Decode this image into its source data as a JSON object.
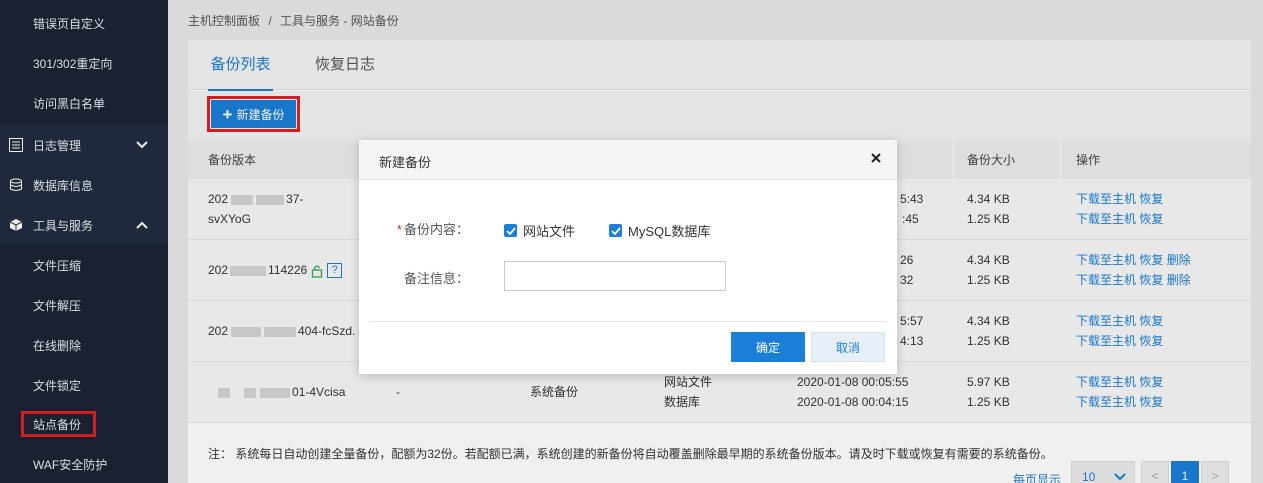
{
  "sidebar": {
    "items": [
      {
        "label": "错误页自定义"
      },
      {
        "label": "301/302重定向"
      },
      {
        "label": "访问黑白名单"
      },
      {
        "label": "日志管理"
      },
      {
        "label": "数据库信息"
      },
      {
        "label": "工具与服务"
      },
      {
        "label": "文件压缩"
      },
      {
        "label": "文件解压"
      },
      {
        "label": "在线删除"
      },
      {
        "label": "文件锁定"
      },
      {
        "label": "站点备份"
      },
      {
        "label": "WAF安全防护"
      }
    ]
  },
  "breadcrumb": {
    "home": "主机控制面板",
    "sep": "/",
    "current": "工具与服务 - 网站备份"
  },
  "tabs": [
    {
      "label": "备份列表"
    },
    {
      "label": "恢复日志"
    }
  ],
  "toolbar": {
    "new_label": "新建备份",
    "plus": "+"
  },
  "table": {
    "headers": [
      "备份版本",
      "备份大小",
      "操作"
    ],
    "rows": [
      {
        "ver1": "202",
        "ver1b": "37-",
        "ver2": "svXYoG",
        "time1": "5:43",
        "time2": ":45",
        "size1": "4.34 KB",
        "size2": "1.25 KB",
        "dl": "下载至主机",
        "rs": "恢复",
        "del": ""
      },
      {
        "ver1": "202",
        "ver1b": "114226",
        "help": "?",
        "time1": "26",
        "time2": "32",
        "size1": "4.34 KB",
        "size2": "1.25 KB",
        "dl": "下载至主机",
        "rs": "恢复",
        "del": "删除"
      },
      {
        "ver1": "202",
        "ver1b": "404-fcSzd.",
        "time1": "5:57",
        "time2": "4:13",
        "size1": "4.34 KB",
        "size2": "1.25 KB",
        "dl": "下载至主机",
        "rs": "恢复",
        "del": ""
      },
      {
        "ver1": "",
        "ver1b": "01-4Vcisa",
        "note": "-",
        "type": "系统备份",
        "c1": "网站文件",
        "c2": "数据库",
        "time1": "2020-01-08 00:05:55",
        "time2": "2020-01-08 00:04:15",
        "size1": "5.97 KB",
        "size2": "1.25 KB",
        "dl": "下载至主机",
        "rs": "恢复",
        "del": ""
      }
    ]
  },
  "footer_note": "注：  系统每日自动创建全量备份，配额为32份。若配额已满，系统创建的新备份将自动覆盖删除最早期的系统备份版本。请及时下载或恢复有需要的系统备份。",
  "pager": {
    "label": "每页显示",
    "page_size": "10",
    "prev": "<",
    "current": "1",
    "next": ">"
  },
  "modal": {
    "title": "新建备份",
    "close": "×",
    "content_label": "备份内容：",
    "required_mark": "*",
    "opt_site": "网站文件",
    "opt_mysql": "MySQL数据库",
    "note_label": "备注信息：",
    "note_value": "",
    "ok": "确定",
    "cancel": "取消"
  },
  "colors": {
    "accent": "#1b7fd8",
    "sidebar_bg": "#1c2536",
    "highlight": "#e02020"
  }
}
